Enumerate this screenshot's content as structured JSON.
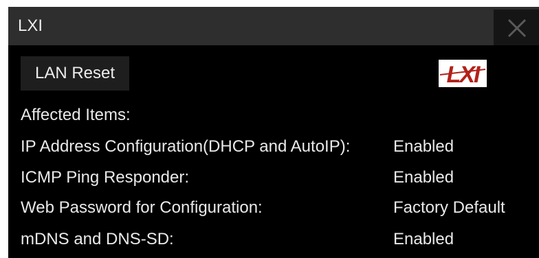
{
  "window": {
    "title": "LXI",
    "close_icon": "close-icon"
  },
  "actions": {
    "lan_reset_label": "LAN Reset"
  },
  "logo": {
    "text": "LXI",
    "color": "#b2211a"
  },
  "affected": {
    "heading": "Affected Items:",
    "items": [
      {
        "label": "IP Address Configuration(DHCP and AutoIP):",
        "value": "Enabled"
      },
      {
        "label": "ICMP Ping Responder:",
        "value": "Enabled"
      },
      {
        "label": "Web Password for Configuration:",
        "value": "Factory Default"
      },
      {
        "label": "mDNS and DNS-SD:",
        "value": "Enabled"
      }
    ]
  },
  "colors": {
    "background": "#000000",
    "titlebar": "#2e2e2e",
    "button": "#1e1e1e",
    "text": "#e9e9e9"
  }
}
